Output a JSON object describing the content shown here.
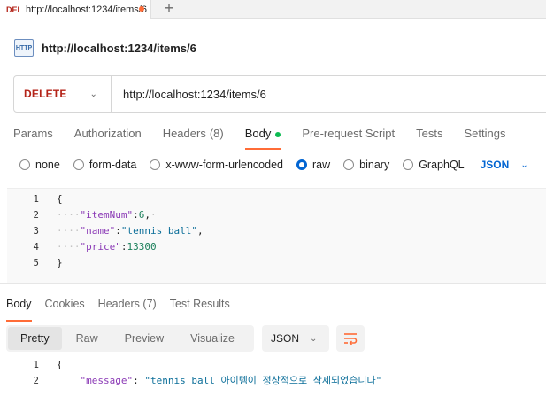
{
  "tab": {
    "method": "DEL",
    "title": "http://localhost:1234/items/6",
    "add_icon": "plus-icon"
  },
  "request": {
    "icon_label": "HTTP",
    "title": "http://localhost:1234/items/6",
    "method": "DELETE",
    "url": "http://localhost:1234/items/6"
  },
  "request_tabs": {
    "params": "Params",
    "authorization": "Authorization",
    "headers": "Headers",
    "headers_count": "(8)",
    "body": "Body",
    "pre_request": "Pre-request Script",
    "tests": "Tests",
    "settings": "Settings"
  },
  "body_types": {
    "none": "none",
    "form_data": "form-data",
    "urlencoded": "x-www-form-urlencoded",
    "raw": "raw",
    "binary": "binary",
    "graphql": "GraphQL",
    "selected": "raw",
    "language": "JSON"
  },
  "request_body": {
    "line_numbers": [
      "1",
      "2",
      "3",
      "4",
      "5"
    ],
    "open_brace": "{",
    "close_brace": "}",
    "fields": [
      {
        "key": "\"itemNum\"",
        "sep": ":",
        "value": "6",
        "end": ","
      },
      {
        "key": "\"name\"",
        "sep": ":",
        "value": "\"tennis ball\"",
        "end": ","
      },
      {
        "key": "\"price\"",
        "sep": ":",
        "value": "13300",
        "end": ""
      }
    ]
  },
  "response_tabs": {
    "body": "Body",
    "cookies": "Cookies",
    "headers": "Headers",
    "headers_count": "(7)",
    "test_results": "Test Results"
  },
  "view_modes": {
    "pretty": "Pretty",
    "raw": "Raw",
    "preview": "Preview",
    "visualize": "Visualize",
    "format": "JSON"
  },
  "response_body": {
    "line_numbers": [
      "1",
      "2"
    ],
    "open_brace": "{",
    "key": "\"message\"",
    "sep": ": ",
    "value": "\"tennis ball 아이템이 정상적으로 삭제되었습니다\""
  },
  "colors": {
    "accent": "#ff6c37",
    "delete": "#b42318",
    "link": "#0265d2",
    "status_dot": "#0cbb52"
  }
}
